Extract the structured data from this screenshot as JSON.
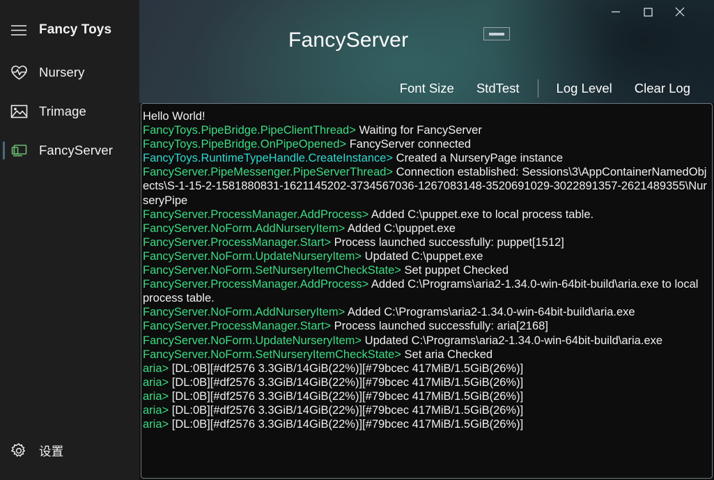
{
  "sidebar": {
    "menu_icon": "hamburger-icon",
    "app_name": "Fancy Toys",
    "items": [
      {
        "label": "Nursery",
        "icon": "heart-pulse-icon",
        "selected": false
      },
      {
        "label": "Trimage",
        "icon": "image-icon",
        "selected": false
      },
      {
        "label": "FancyServer",
        "icon": "monitor-icon",
        "selected": true
      }
    ],
    "settings": {
      "label": "设置",
      "icon": "gear-icon"
    }
  },
  "header": {
    "title": "FancyServer",
    "collapse_button": "collapse-bar-icon",
    "window_controls": {
      "minimize": "minimize-icon",
      "maximize": "maximize-icon",
      "close": "close-icon"
    },
    "toolbar": {
      "font_size": "Font Size",
      "std_test": "StdTest",
      "log_level": "Log Level",
      "clear_log": "Clear Log"
    }
  },
  "colors": {
    "log_green": "#3ddc84",
    "log_cyan": "#2fd9d0",
    "log_text": "#f0f0f0",
    "accent_bar": "#4a6b80",
    "sidebar_bg": "#1e1e1e",
    "log_bg": "#0d0d0d",
    "header_teal": "#2e4e50"
  },
  "log": {
    "lines": [
      {
        "src": "",
        "sep": "",
        "msg": "Hello World!",
        "color": "#f0f0f0"
      },
      {
        "src": "FancyToys.PipeBridge.PipeClientThread",
        "sep": ">",
        "msg": " Waiting for FancyServer",
        "color": "#3ddc84"
      },
      {
        "src": "FancyToys.PipeBridge.OnPipeOpened",
        "sep": ">",
        "msg": " FancyServer connected",
        "color": "#3ddc84"
      },
      {
        "src": "FancyToys.RuntimeTypeHandle.CreateInstance",
        "sep": ">",
        "msg": " Created a NurseryPage instance",
        "color": "#2fd9d0"
      },
      {
        "src": "FancyServer.PipeMessenger.PipeServerThread",
        "sep": ">",
        "msg": " Connection established: Sessions\\3\\AppContainerNamedObjects\\S-1-15-2-1581880831-1621145202-3734567036-1267083148-3520691029-3022891357-2621489355\\NurseryPipe",
        "color": "#3ddc84"
      },
      {
        "src": "FancyServer.ProcessManager.AddProcess",
        "sep": ">",
        "msg": " Added C:\\puppet.exe to local process table.",
        "color": "#3ddc84"
      },
      {
        "src": "FancyServer.NoForm.AddNurseryItem",
        "sep": ">",
        "msg": " Added C:\\puppet.exe",
        "color": "#3ddc84"
      },
      {
        "src": "FancyServer.ProcessManager.Start",
        "sep": ">",
        "msg": " Process launched successfully: puppet[1512]",
        "color": "#3ddc84"
      },
      {
        "src": "FancyServer.NoForm.UpdateNurseryItem",
        "sep": ">",
        "msg": " Updated C:\\puppet.exe",
        "color": "#3ddc84"
      },
      {
        "src": "FancyServer.NoForm.SetNurseryItemCheckState",
        "sep": ">",
        "msg": " Set puppet Checked",
        "color": "#3ddc84"
      },
      {
        "src": "FancyServer.ProcessManager.AddProcess",
        "sep": ">",
        "msg": " Added C:\\Programs\\aria2-1.34.0-win-64bit-build\\aria.exe to local process table.",
        "color": "#3ddc84"
      },
      {
        "src": "FancyServer.NoForm.AddNurseryItem",
        "sep": ">",
        "msg": " Added C:\\Programs\\aria2-1.34.0-win-64bit-build\\aria.exe",
        "color": "#3ddc84"
      },
      {
        "src": "FancyServer.ProcessManager.Start",
        "sep": ">",
        "msg": " Process launched successfully: aria[2168]",
        "color": "#3ddc84"
      },
      {
        "src": "FancyServer.NoForm.UpdateNurseryItem",
        "sep": ">",
        "msg": " Updated C:\\Programs\\aria2-1.34.0-win-64bit-build\\aria.exe",
        "color": "#3ddc84"
      },
      {
        "src": "FancyServer.NoForm.SetNurseryItemCheckState",
        "sep": ">",
        "msg": " Set aria Checked",
        "color": "#3ddc84"
      },
      {
        "src": "aria",
        "sep": ">",
        "msg": " [DL:0B][#df2576 3.3GiB/14GiB(22%)][#79bcec 417MiB/1.5GiB(26%)]",
        "color": "#3ddc84"
      },
      {
        "src": "aria",
        "sep": ">",
        "msg": " [DL:0B][#df2576 3.3GiB/14GiB(22%)][#79bcec 417MiB/1.5GiB(26%)]",
        "color": "#3ddc84"
      },
      {
        "src": "aria",
        "sep": ">",
        "msg": " [DL:0B][#df2576 3.3GiB/14GiB(22%)][#79bcec 417MiB/1.5GiB(26%)]",
        "color": "#3ddc84"
      },
      {
        "src": "aria",
        "sep": ">",
        "msg": " [DL:0B][#df2576 3.3GiB/14GiB(22%)][#79bcec 417MiB/1.5GiB(26%)]",
        "color": "#3ddc84"
      },
      {
        "src": "aria",
        "sep": ">",
        "msg": " [DL:0B][#df2576 3.3GiB/14GiB(22%)][#79bcec 417MiB/1.5GiB(26%)]",
        "color": "#3ddc84"
      }
    ]
  }
}
